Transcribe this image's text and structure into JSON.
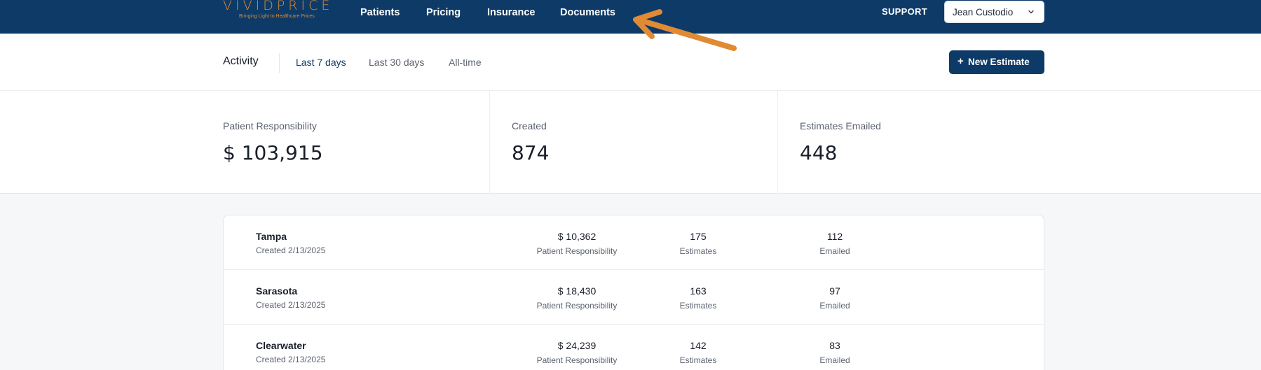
{
  "header": {
    "logo_text": "VIVIDPRICE",
    "logo_tagline": "Bringing Light to Healthcare Prices",
    "nav": [
      "Patients",
      "Pricing",
      "Insurance",
      "Documents"
    ],
    "support_label": "SUPPORT",
    "user_name": "Jean Custodio"
  },
  "activity": {
    "title": "Activity",
    "tabs": [
      "Last 7 days",
      "Last 30 days",
      "All-time"
    ],
    "active_tab": "Last 7 days",
    "new_button_label": "New Estimate"
  },
  "stats": [
    {
      "label": "Patient Responsibility",
      "value": "$ 103,915"
    },
    {
      "label": "Created",
      "value": "874"
    },
    {
      "label": "Estimates Emailed",
      "value": "448"
    }
  ],
  "locations": [
    {
      "name": "Tampa",
      "created": "Created 2/13/2025",
      "responsibility": "$ 10,362",
      "responsibility_label": "Patient Responsibility",
      "estimates": "175",
      "estimates_label": "Estimates",
      "emailed": "112",
      "emailed_label": "Emailed"
    },
    {
      "name": "Sarasota",
      "created": "Created 2/13/2025",
      "responsibility": "$ 18,430",
      "responsibility_label": "Patient Responsibility",
      "estimates": "163",
      "estimates_label": "Estimates",
      "emailed": "97",
      "emailed_label": "Emailed"
    },
    {
      "name": "Clearwater",
      "created": "Created 2/13/2025",
      "responsibility": "$ 24,239",
      "responsibility_label": "Patient Responsibility",
      "estimates": "142",
      "estimates_label": "Estimates",
      "emailed": "83",
      "emailed_label": "Emailed"
    }
  ],
  "colors": {
    "primary": "#0e3a67",
    "accent": "#d98a34",
    "arrow": "#e08a34"
  },
  "icons": {
    "user_menu": "chevron-down-icon",
    "new_estimate": "plus-icon",
    "annotation": "arrow-icon"
  }
}
